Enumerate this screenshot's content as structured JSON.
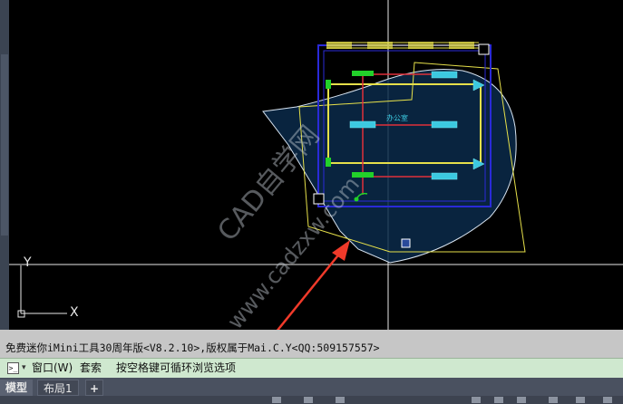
{
  "canvas": {
    "room_label": "办公室",
    "watermark_main": "CAD自学网",
    "watermark_url": "www.cadzxw.com",
    "ucs_y": "Y",
    "ucs_x": "X"
  },
  "command": {
    "history_text": "免费迷你iMini工具30周年版<V8.2.10>,版权属于Mai.C.Y<QQ:509157557>",
    "prompt": "窗口(W)",
    "option": "套索",
    "hint": "按空格键可循环浏览选项"
  },
  "tabs": {
    "model": "模型",
    "layout1": "布局1",
    "add": "+"
  },
  "colors": {
    "background": "#000000",
    "selection_fill": "#0a2a4a",
    "lasso_outline": "#d7e3f0",
    "yellow_lines": "#e6e04a",
    "red_lines": "#e0303a",
    "fixture_cyan": "#3cc9e0",
    "green_elements": "#22d12a",
    "blue_walls": "#2a2ad8",
    "arrow": "#f03a2a",
    "command_line_bg": "#cfe8cf",
    "tab_bar": "#4a5160"
  }
}
